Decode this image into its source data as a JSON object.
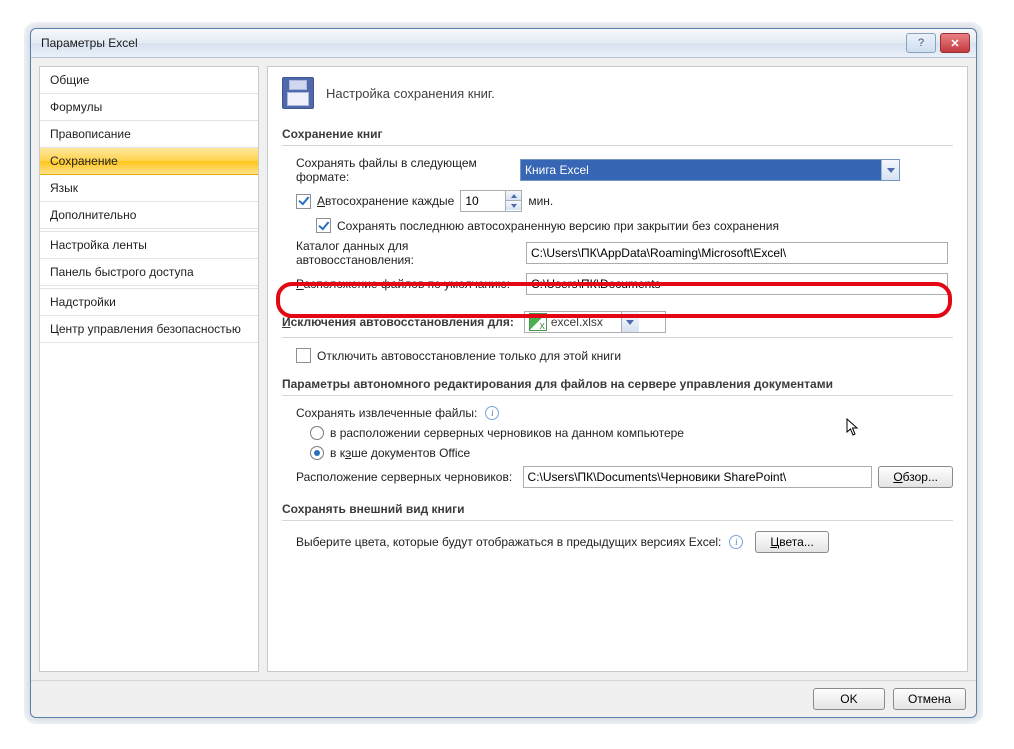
{
  "window": {
    "title": "Параметры Excel"
  },
  "sidebar": {
    "items": [
      {
        "label": "Общие"
      },
      {
        "label": "Формулы"
      },
      {
        "label": "Правописание"
      },
      {
        "label": "Сохранение"
      },
      {
        "label": "Язык"
      },
      {
        "label": "Дополнительно"
      },
      {
        "label": "Настройка ленты"
      },
      {
        "label": "Панель быстрого доступа"
      },
      {
        "label": "Надстройки"
      },
      {
        "label": "Центр управления безопасностью"
      }
    ],
    "selected_index": 3
  },
  "page": {
    "title": "Настройка сохранения книг.",
    "sec_save": {
      "header": "Сохранение книг",
      "format_label": "Сохранять файлы в следующем формате:",
      "format_value": "Книга Excel",
      "autosave_prefix": "Автосохранение каждые",
      "autosave_value": "10",
      "autosave_suffix": "мин.",
      "keep_last_label": "Сохранять последнюю автосохраненную версию при закрытии без сохранения",
      "catalog_label": "Каталог данных для автовосстановления:",
      "catalog_value": "C:\\Users\\ПК\\AppData\\Roaming\\Microsoft\\Excel\\",
      "default_loc_label": "Расположение файлов по умолчанию:",
      "default_loc_value": "C:\\Users\\ПК\\Documents"
    },
    "sec_excl": {
      "header": "Исключения автовосстановления для:",
      "file": "excel.xlsx",
      "disable_label": "Отключить автовосстановление только для этой книги"
    },
    "sec_offline": {
      "header": "Параметры автономного редактирования для файлов на сервере управления документами",
      "save_extracted_label": "Сохранять извлеченные файлы:",
      "opt_server": "в расположении серверных черновиков на данном компьютере",
      "opt_cache": "в кэше документов Office",
      "drafts_label": "Расположение серверных черновиков:",
      "drafts_value": "C:\\Users\\ПК\\Documents\\Черновики SharePoint\\",
      "browse": "Обзор..."
    },
    "sec_appearance": {
      "header": "Сохранять внешний вид книги",
      "colors_prompt": "Выберите цвета, которые будут отображаться в предыдущих версиях Excel:",
      "colors_btn": "Цвета..."
    }
  },
  "footer": {
    "ok": "OK",
    "cancel": "Отмена"
  }
}
